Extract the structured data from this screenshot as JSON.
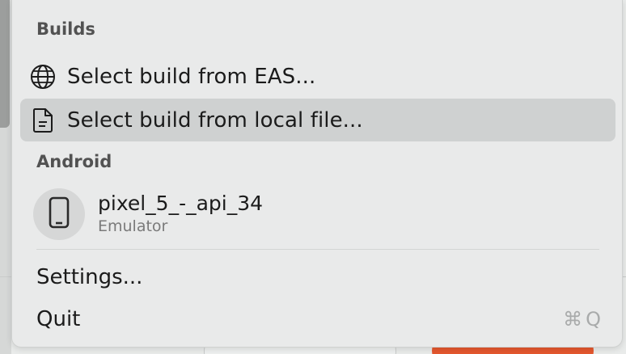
{
  "menu": {
    "builds_header": "Builds",
    "items": [
      {
        "label": "Select build from EAS...",
        "icon": "globe-icon"
      },
      {
        "label": "Select build from local file...",
        "icon": "file-icon",
        "selected": true
      }
    ],
    "android_header": "Android",
    "device": {
      "name": "pixel_5_-_api_34",
      "type": "Emulator",
      "icon": "phone-icon"
    },
    "settings_label": "Settings...",
    "quit_label": "Quit",
    "quit_shortcut": "⌘Q"
  },
  "colors": {
    "selected_bg": "#cfd1d1",
    "menu_bg": "#e9eaea",
    "accent_orange": "#e4572e"
  }
}
